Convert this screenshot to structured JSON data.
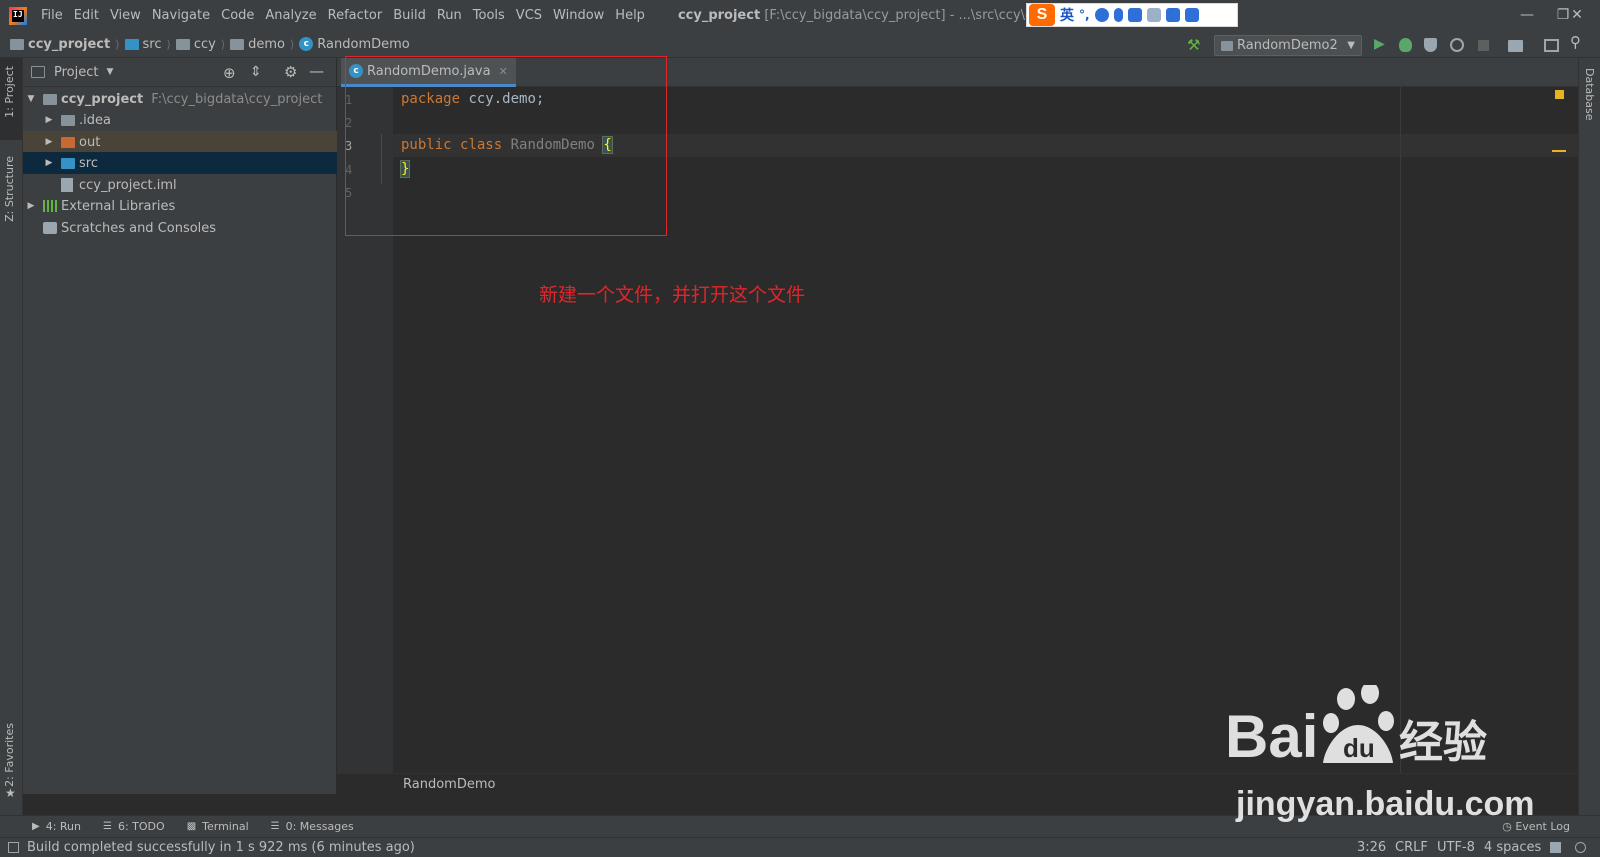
{
  "menubar": {
    "items": [
      "File",
      "Edit",
      "View",
      "Navigate",
      "Code",
      "Analyze",
      "Refactor",
      "Build",
      "Run",
      "Tools",
      "VCS",
      "Window",
      "Help"
    ],
    "title_project": "ccy_project",
    "title_path": "[F:\\ccy_bigdata\\ccy_project] - ...\\src\\ccy\\demo\\"
  },
  "ime": {
    "logo": "S",
    "mode": "英",
    "punct": "°,"
  },
  "navbar": {
    "crumbs": [
      "ccy_project",
      "src",
      "ccy",
      "demo",
      "RandomDemo"
    ],
    "run_config": "RandomDemo2"
  },
  "left_stripe": {
    "project_tab": "1: Project",
    "structure_tab": "Z: Structure",
    "favorites_tab": "2: Favorites"
  },
  "right_stripe": {
    "database_tab": "Database"
  },
  "project_panel": {
    "title": "Project",
    "tree": [
      {
        "label": "ccy_project",
        "path": "F:\\ccy_bigdata\\ccy_project"
      },
      {
        "label": ".idea"
      },
      {
        "label": "out"
      },
      {
        "label": "src"
      },
      {
        "label": "ccy_project.iml"
      },
      {
        "label": "External Libraries"
      },
      {
        "label": "Scratches and Consoles"
      }
    ]
  },
  "editor": {
    "tab_label": "RandomDemo.java",
    "line_numbers": [
      "1",
      "2",
      "3",
      "4",
      "5"
    ],
    "code": {
      "l1_kw": "package",
      "l1_rest": " ccy.demo;",
      "l3_kw1": "public",
      "l3_kw2": "class",
      "l3_class": "RandomDemo",
      "l3_brace": "{",
      "l4_brace": "}"
    },
    "footer_breadcrumb": "RandomDemo"
  },
  "annotation": {
    "text": "新建一个文件，并打开这个文件"
  },
  "bottom_tools": {
    "run": "4: Run",
    "todo": "6: TODO",
    "terminal": "Terminal",
    "messages": "0: Messages",
    "event_log": "Event Log"
  },
  "statusbar": {
    "message": "Build completed successfully in 1 s 922 ms (6 minutes ago)",
    "position": "3:26",
    "line_sep": "CRLF",
    "encoding": "UTF-8",
    "indent": "4 spaces"
  },
  "watermark": {
    "text": "jingyan.baidu.com",
    "brand": "Bai",
    "brand2": "经验"
  },
  "colors": {
    "accent": "#4a88c7",
    "annotation": "#e2252b",
    "keyword": "#cc7832",
    "bg": "#2b2b2b"
  }
}
